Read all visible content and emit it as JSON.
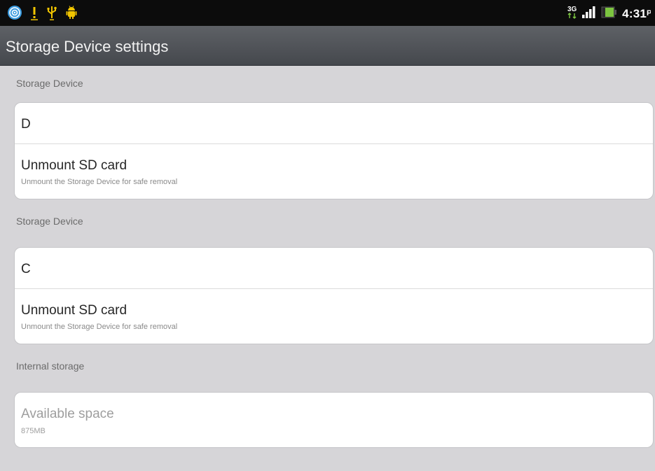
{
  "status_bar": {
    "icons_left": [
      "location-icon",
      "alert-icon",
      "usb-icon",
      "android-debug-icon"
    ],
    "network_type": "3G",
    "time": "4:31",
    "am_pm": "PM"
  },
  "title_bar": {
    "title": "Storage Device settings"
  },
  "sections": [
    {
      "header": "Storage Device",
      "rows": [
        {
          "title": "D"
        },
        {
          "title": "Unmount SD card",
          "subtitle": "Unmount the Storage Device for safe removal"
        }
      ]
    },
    {
      "header": "Storage Device",
      "rows": [
        {
          "title": "C"
        },
        {
          "title": "Unmount SD card",
          "subtitle": "Unmount the Storage Device for safe removal"
        }
      ]
    },
    {
      "header": "Internal storage",
      "rows": [
        {
          "title": "Available space",
          "subtitle": "875MB"
        }
      ]
    }
  ],
  "colors": {
    "status_bar_bg": "#0c0c0c",
    "title_bar_bg": "#505358",
    "page_bg": "#d6d5d8",
    "card_bg": "#ffffff",
    "battery_green": "#7cc540"
  }
}
